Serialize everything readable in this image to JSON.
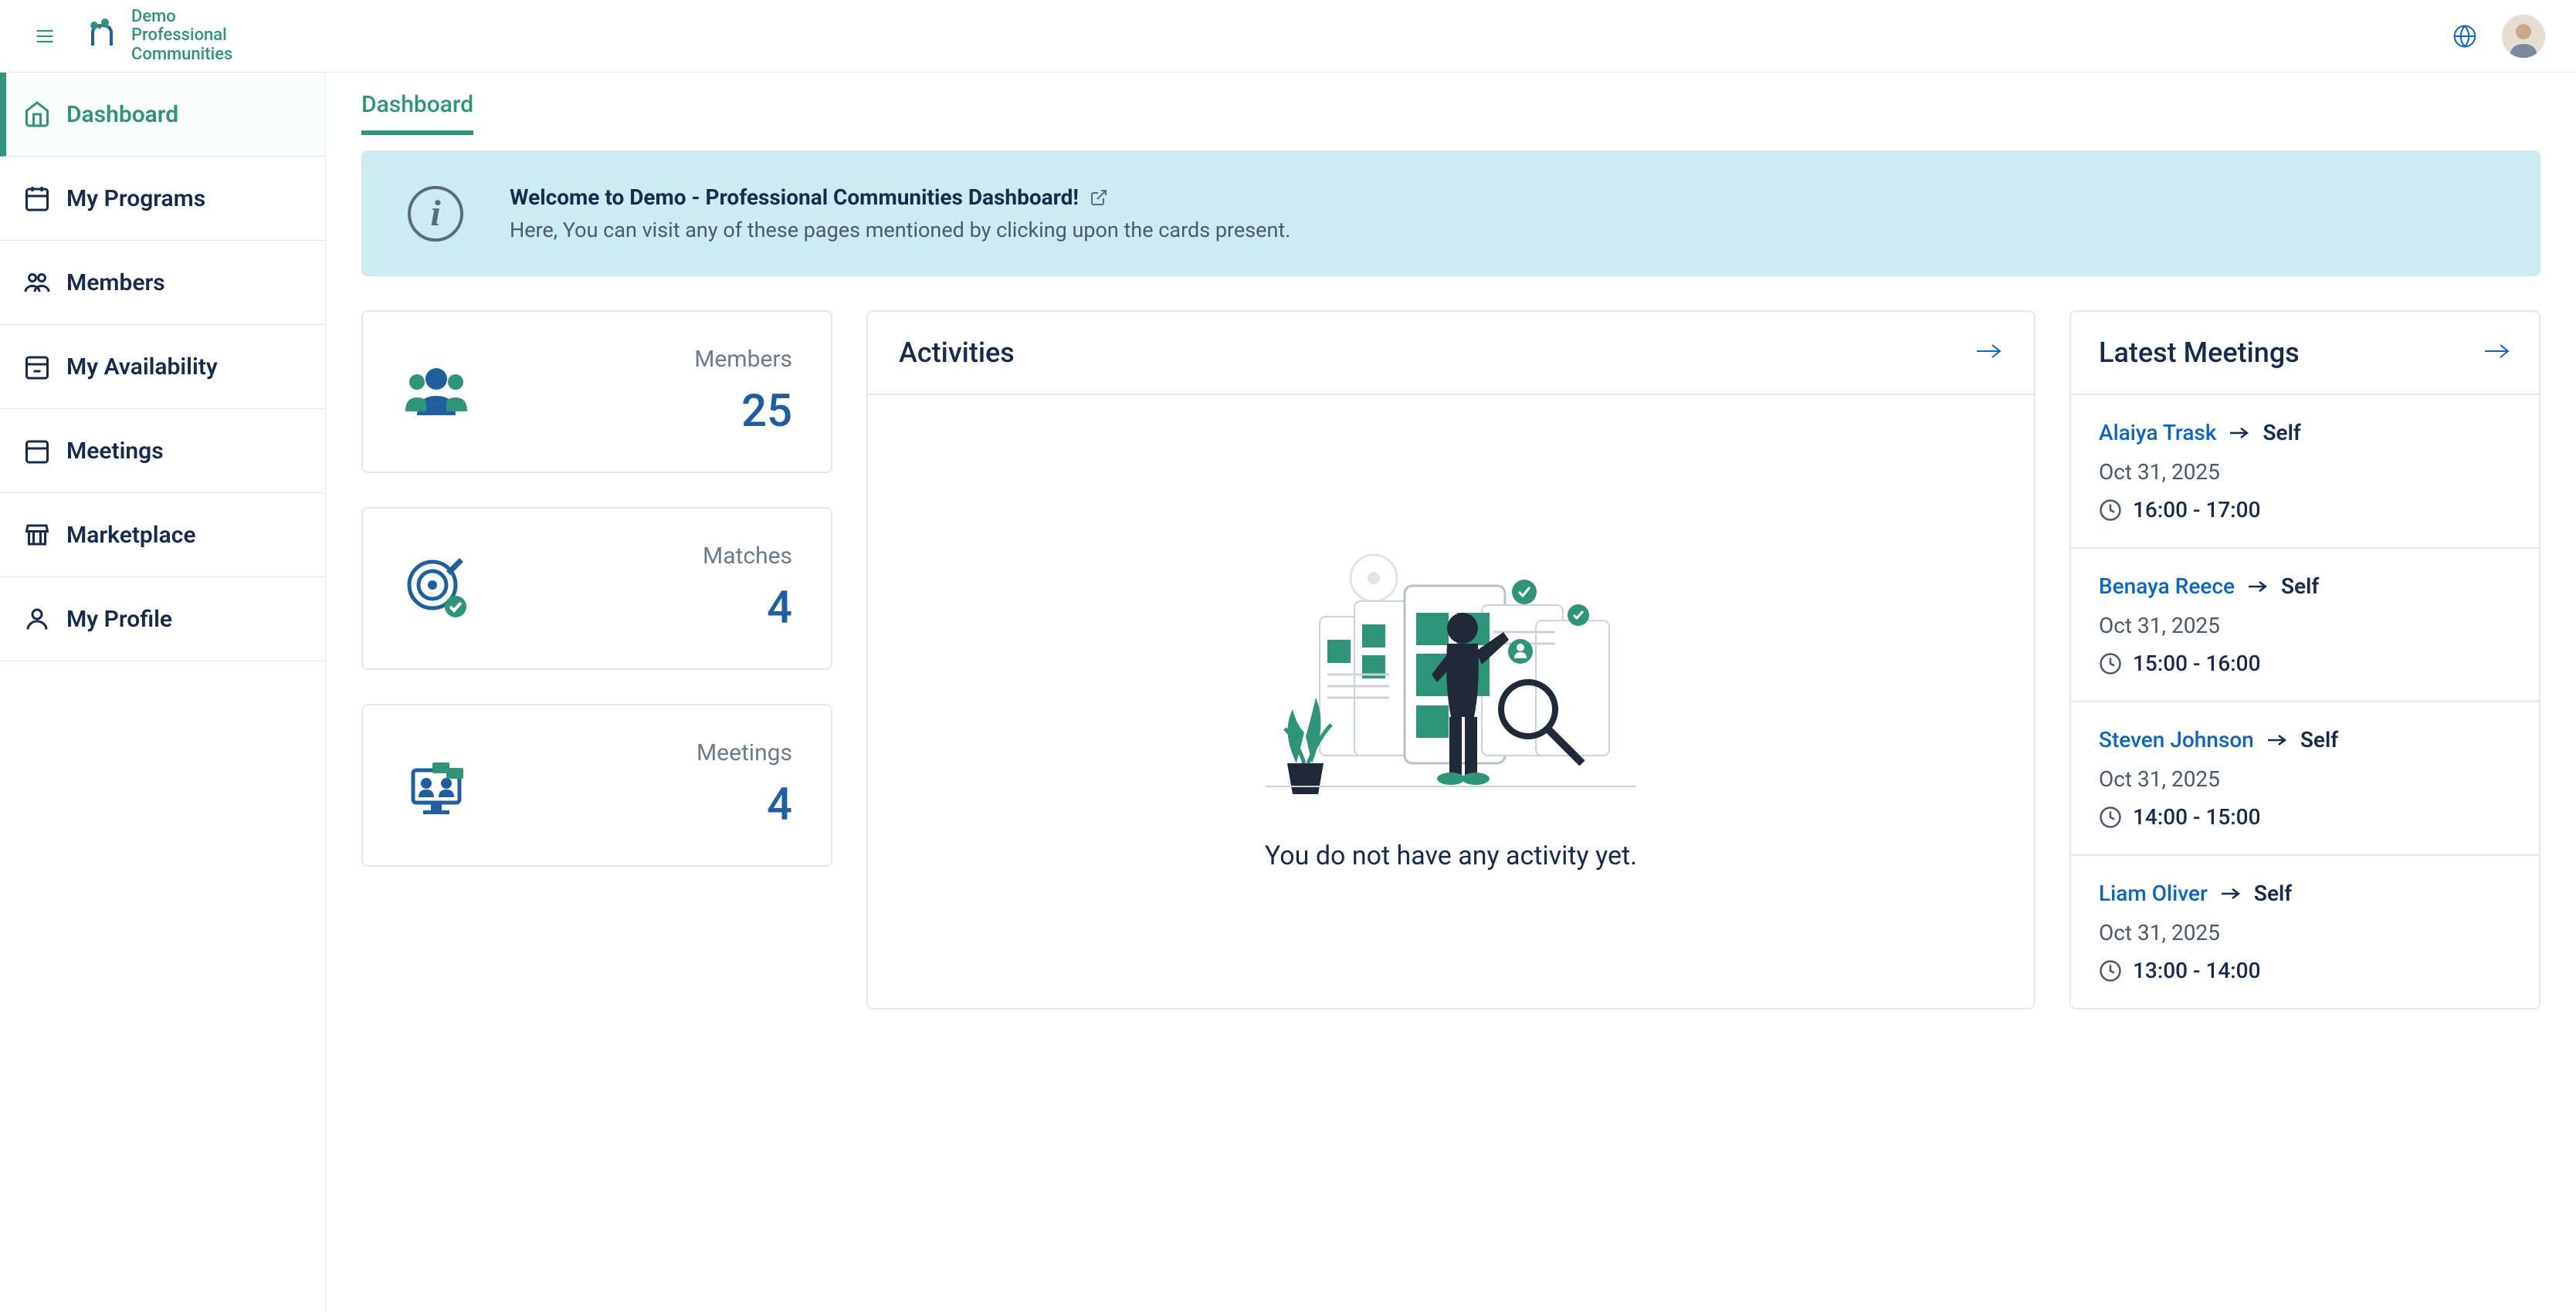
{
  "header": {
    "logo_line1": "Demo",
    "logo_line2": "Professional",
    "logo_line3": "Communities"
  },
  "sidebar": {
    "items": [
      {
        "label": "Dashboard",
        "icon": "home"
      },
      {
        "label": "My Programs",
        "icon": "calendar-range"
      },
      {
        "label": "Members",
        "icon": "users"
      },
      {
        "label": "My Availability",
        "icon": "calendar-check"
      },
      {
        "label": "Meetings",
        "icon": "calendar"
      },
      {
        "label": "Marketplace",
        "icon": "store"
      },
      {
        "label": "My Profile",
        "icon": "user"
      }
    ]
  },
  "breadcrumb": {
    "label": "Dashboard"
  },
  "banner": {
    "title": "Welcome to Demo - Professional Communities Dashboard!",
    "description": "Here, You can visit any of these pages mentioned by clicking upon the cards present."
  },
  "stats": [
    {
      "label": "Members",
      "value": "25",
      "icon": "people"
    },
    {
      "label": "Matches",
      "value": "4",
      "icon": "target"
    },
    {
      "label": "Meetings",
      "value": "4",
      "icon": "meeting"
    }
  ],
  "activities": {
    "title": "Activities",
    "empty": "You do not have any activity yet."
  },
  "meetings": {
    "title": "Latest Meetings",
    "items": [
      {
        "person1": "Alaiya Trask",
        "person2": "Self",
        "date": "Oct 31, 2025",
        "time": "16:00 - 17:00"
      },
      {
        "person1": "Benaya Reece",
        "person2": "Self",
        "date": "Oct 31, 2025",
        "time": "15:00 - 16:00"
      },
      {
        "person1": "Steven Johnson",
        "person2": "Self",
        "date": "Oct 31, 2025",
        "time": "14:00 - 15:00"
      },
      {
        "person1": "Liam Oliver",
        "person2": "Self",
        "date": "Oct 31, 2025",
        "time": "13:00 - 14:00"
      }
    ]
  }
}
